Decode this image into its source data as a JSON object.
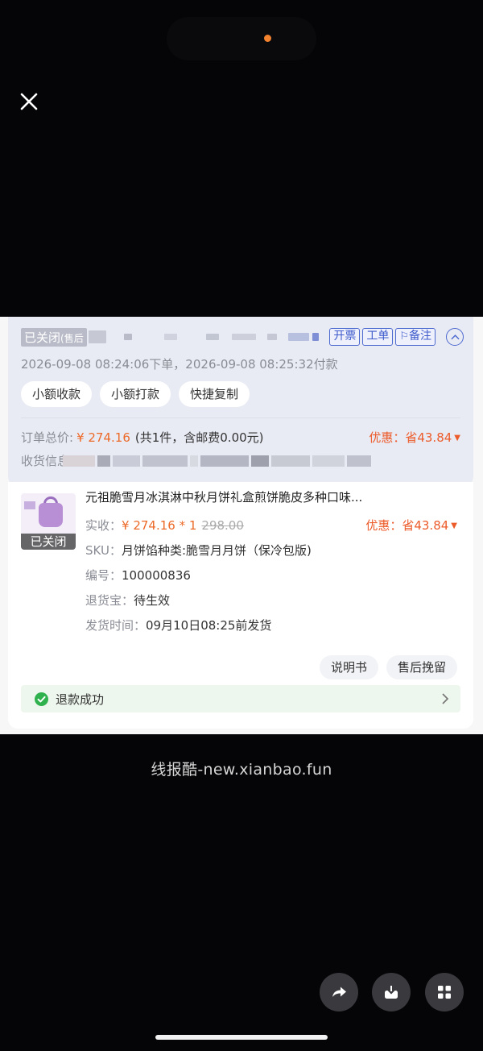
{
  "head": {
    "status": "已关闭",
    "status_sub": "(售后",
    "actions": {
      "invoice": "开票",
      "ticket": "工单",
      "remark": "备注"
    },
    "time_line": "2026-09-08 08:24:06下单，2026-09-08 08:25:32付款",
    "pills": [
      "小额收款",
      "小额打款",
      "快捷复制"
    ],
    "total_label": "订单总价:",
    "total_price": "¥ 274.16",
    "total_info": "(共1件，含邮费0.00元)",
    "discount": "优惠：省43.84",
    "address_label": "收货信息"
  },
  "item": {
    "badge": "已关闭",
    "title": "元祖脆雪月冰淇淋中秋月饼礼盒煎饼脆皮多种口味...",
    "paid_label": "实收：",
    "paid_value": "¥ 274.16 * 1",
    "original_price": "298.00",
    "discount": "优惠：省43.84",
    "sku_label": "SKU：",
    "sku_value": "月饼馅种类:脆雪月月饼（保冷包版)",
    "code_label": "编号：",
    "code_value": "100000836",
    "return_label": "退货宝：",
    "return_value": "待生效",
    "ship_label": "发货时间：",
    "ship_value": "09月10日08:25前发货",
    "buttons": [
      "说明书",
      "售后挽留"
    ],
    "refund_status": "退款成功"
  },
  "watermark": "线报酷-new.xianbao.fun",
  "colors": {
    "accent": "#3f5bcc",
    "price": "#ec6a28",
    "success": "#2fb14d"
  },
  "icons": [
    "close-icon",
    "collapse-up-icon",
    "check-circle-icon",
    "chevron-right-icon",
    "share-icon",
    "download-icon",
    "grid-icon"
  ]
}
